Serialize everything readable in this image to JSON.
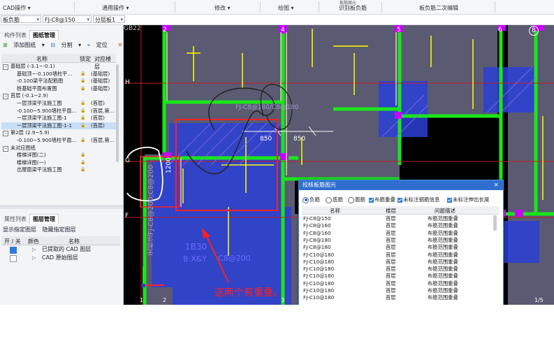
{
  "ribbon": {
    "groups": [
      "CAD操作",
      "通用操作",
      "修改",
      "绘图",
      "识别板负筋",
      "板负筋二次编辑"
    ],
    "partial_top": "板筋图元"
  },
  "propbar": {
    "element_type": "板负筋",
    "name": "FJ-C8@150",
    "layer": "分层板1"
  },
  "left": {
    "tabs": [
      "构件列表",
      "图纸管理"
    ],
    "toolbar": [
      "添加图纸",
      "分割",
      "定位",
      "删除"
    ],
    "columns": {
      "name": "名称",
      "lock": "锁定",
      "floor": "对应楼层"
    },
    "groups": [
      {
        "label": "基础层 (-3.1~-0.1)",
        "items": [
          {
            "name": "基础顶~-0.100墙柱平...",
            "floor": "(基础层)"
          },
          {
            "name": "-0.100梁平法配筋图",
            "floor": "(基础层)"
          },
          {
            "name": "桩基础平面布置图",
            "floor": "(基础层)"
          }
        ]
      },
      {
        "label": "首层 (-0.1~2.9)",
        "items": [
          {
            "name": "一层顶梁平法施工图",
            "floor": "(首层)"
          },
          {
            "name": "-0.100~5.900墙柱平面...",
            "floor": "(首层,第..."
          },
          {
            "name": "一层顶梁平法施工图-1",
            "floor": "(首层)"
          },
          {
            "name": "一层顶梁平法施工图-1-1",
            "floor": "(首层)"
          }
        ]
      },
      {
        "label": "第2层 (2.9~5.9)",
        "items": [
          {
            "name": "-0.100~5.900墙柱平面...",
            "floor": "(首层,第..."
          }
        ]
      },
      {
        "label": "未对应图纸",
        "items": [
          {
            "name": "楼梯详图(二)",
            "floor": ""
          },
          {
            "name": "楼梯详图(一)",
            "floor": ""
          },
          {
            "name": "出屋面梁平法施工图",
            "floor": ""
          }
        ]
      }
    ],
    "layer_tabs": [
      "属性列表",
      "图层管理"
    ],
    "layer_toolbar": [
      "显示指定图层",
      "隐藏指定图层"
    ],
    "layer_columns": {
      "onoff": "开 / 关",
      "color": "颜色",
      "name": "名称"
    },
    "layers": [
      {
        "name": "已提取的 CAD 图层",
        "on": true
      },
      {
        "name": "CAD 原始图层",
        "on": false
      }
    ]
  },
  "canvas": {
    "axis_top": [
      "2",
      "4",
      "5",
      "6",
      "8"
    ],
    "axis_left": [
      "H",
      "G",
      "F"
    ],
    "corner_label": "GB22",
    "dim_labels": [
      "850",
      "850",
      "1200"
    ],
    "rebar_label": "FJ-C8@180/C8@180",
    "vertical_label": "无标注FJ-C8@200;C8@200",
    "inner_label_1": "1B30",
    "inner_label_2": "B:X&Y",
    "inner_label_3": "C8@200",
    "annotation": "这两个有重叠。",
    "bottom_axis": [
      "1",
      "2",
      "3",
      "1/5"
    ]
  },
  "dialog": {
    "title": "校核板筋图元",
    "close": "×",
    "options": {
      "radios": [
        "负筋",
        "底筋",
        "面筋"
      ],
      "selected_radio": "负筋",
      "checkboxes": [
        "布筋重叠",
        "未标注钢筋信息",
        "未标注伸出长度"
      ]
    },
    "columns": {
      "name": "名称",
      "floor": "楼层",
      "issue": "问题描述"
    },
    "rows": [
      {
        "name": "FJ-C8@150",
        "floor": "首层",
        "issue": "布筋范围重叠"
      },
      {
        "name": "FJ-C8@160",
        "floor": "首层",
        "issue": "布筋范围重叠"
      },
      {
        "name": "FJ-C8@160",
        "floor": "首层",
        "issue": "布筋范围重叠"
      },
      {
        "name": "FJ-C8@180",
        "floor": "首层",
        "issue": "布筋范围重叠"
      },
      {
        "name": "FJ-C8@180",
        "floor": "首层",
        "issue": "布筋范围重叠"
      },
      {
        "name": "FJ-C10@180",
        "floor": "首层",
        "issue": "布筋范围重叠"
      },
      {
        "name": "FJ-C10@180",
        "floor": "首层",
        "issue": "布筋范围重叠"
      },
      {
        "name": "FJ-C10@180",
        "floor": "首层",
        "issue": "布筋范围重叠"
      },
      {
        "name": "FJ-C10@180",
        "floor": "首层",
        "issue": "布筋范围重叠"
      },
      {
        "name": "FJ-C10@180",
        "floor": "首层",
        "issue": "布筋范围重叠"
      },
      {
        "name": "FJ-C10@180",
        "floor": "首层",
        "issue": "布筋范围重叠"
      },
      {
        "name": "FJ-C10@180",
        "floor": "首层",
        "issue": "布筋范围重叠"
      }
    ]
  },
  "colors": {
    "canvas_bg": "#000000",
    "slab_fill": "#5a5a72",
    "beam_green": "#19e619",
    "column_magenta": "#c800ff",
    "rebar_yellow": "#ffff00",
    "highlight_red": "#ff2020",
    "blue_fill": "#2a3fd6",
    "annotation_red": "#ff2020",
    "dialog_title": "#2e6fcf"
  }
}
